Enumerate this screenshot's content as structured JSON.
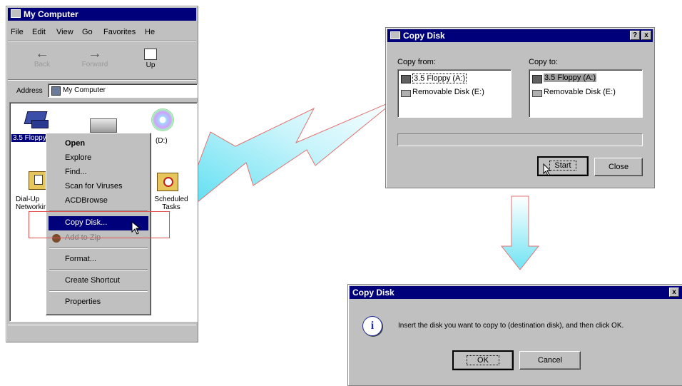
{
  "explorer": {
    "title": "My Computer",
    "menu": [
      "File",
      "Edit",
      "View",
      "Go",
      "Favorites",
      "He"
    ],
    "toolbar": {
      "back": "Back",
      "forward": "Forward",
      "up": "Up"
    },
    "address_label": "Address",
    "address_value": "My Computer",
    "icons": {
      "floppy": "3.5 Floppy",
      "removable": "",
      "cd": "(D:)",
      "dialup": "Dial-Up Networking",
      "scheduled": "Scheduled Tasks"
    }
  },
  "context_menu": {
    "open": "Open",
    "explore": "Explore",
    "find": "Find...",
    "scan": "Scan for Viruses",
    "acdbrowse": "ACDBrowse",
    "copy_disk": "Copy Disk...",
    "add_zip": "Add to Zip",
    "format": "Format...",
    "create_shortcut": "Create Shortcut",
    "properties": "Properties"
  },
  "copy_disk_dialog": {
    "title": "Copy Disk",
    "copy_from_label": "Copy from:",
    "copy_to_label": "Copy to:",
    "from_items": [
      "3.5 Floppy (A:)",
      "Removable Disk (E:)"
    ],
    "to_items": [
      "3.5 Floppy (A:)",
      "Removable Disk (E:)"
    ],
    "start": "Start",
    "close": "Close",
    "help_btn": "?",
    "close_btn": "x"
  },
  "prompt_dialog": {
    "title": "Copy Disk",
    "message": "Insert the disk you want to copy to (destination disk), and then click OK.",
    "ok": "OK",
    "cancel": "Cancel",
    "close_btn": "x",
    "info_glyph": "i"
  },
  "colors": {
    "titlebar": "#00007b",
    "face": "#c0c0c0",
    "highlight_box": "#e05050",
    "arrow": "#5fe0f0"
  }
}
